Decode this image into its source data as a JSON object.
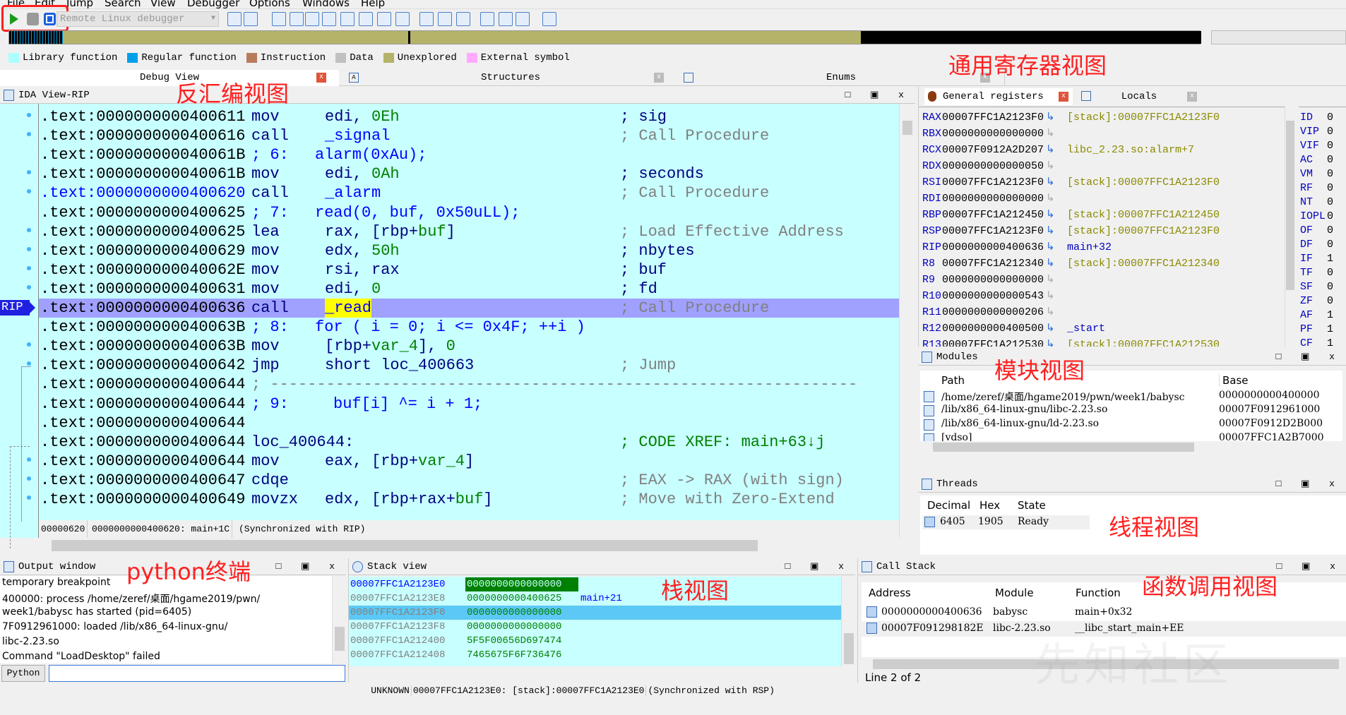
{
  "menu": [
    "File",
    "Edit",
    "Jump",
    "Search",
    "View",
    "Debugger",
    "Options",
    "Windows",
    "Help"
  ],
  "toolbar": {
    "debugger_select": "Remote Linux debugger",
    "icons": [
      "play-icon",
      "pause-icon",
      "stop-icon"
    ]
  },
  "legend": [
    {
      "label": "Library function",
      "color": "#aaffff"
    },
    {
      "label": "Regular function",
      "color": "#00a0e8"
    },
    {
      "label": "Instruction",
      "color": "#b87c5c"
    },
    {
      "label": "Data",
      "color": "#c0c0c0"
    },
    {
      "label": "Unexplored",
      "color": "#b5b36a"
    },
    {
      "label": "External symbol",
      "color": "#ffaaff"
    }
  ],
  "tabs": [
    "Debug View",
    "Structures",
    "Enums"
  ],
  "ida_view": {
    "title": "IDA View-RIP",
    "rip_label": "RIP",
    "lines": [
      {
        "addr": ".text:0000000000400611",
        "dot": true,
        "t": [
          [
            "mov",
            "nv",
            356
          ],
          [
            "edi, ",
            "nv",
            460
          ],
          [
            "0Eh",
            "gr",
            0
          ],
          [
            "; sig",
            "nv",
            878
          ]
        ]
      },
      {
        "addr": ".text:0000000000400616",
        "dot": true,
        "t": [
          [
            "call",
            "nv",
            356
          ],
          [
            "_signal",
            "bl",
            460
          ],
          [
            "; Call Procedure",
            "gy",
            878
          ]
        ]
      },
      {
        "addr": ".text:000000000040061B",
        "dot": false,
        "t": [
          [
            "; 6:",
            "bl",
            356
          ],
          [
            "alarm(0xAu);",
            "bl",
            446
          ]
        ]
      },
      {
        "addr": ".text:000000000040061B",
        "dot": true,
        "t": [
          [
            "mov",
            "nv",
            356
          ],
          [
            "edi, ",
            "nv",
            460
          ],
          [
            "0Ah",
            "gr",
            0
          ],
          [
            "; seconds",
            "nv",
            878
          ]
        ]
      },
      {
        "addr": ".text:0000000000400620",
        "addrblue": true,
        "dot": true,
        "t": [
          [
            "call",
            "nv",
            356
          ],
          [
            "_alarm",
            "bl",
            460
          ],
          [
            "; Call Procedure",
            "gy",
            878
          ]
        ]
      },
      {
        "addr": ".text:0000000000400625",
        "dot": false,
        "t": [
          [
            "; 7:",
            "bl",
            356
          ],
          [
            "read(0, buf, 0x50uLL);",
            "bl",
            446
          ]
        ]
      },
      {
        "addr": ".text:0000000000400625",
        "dot": true,
        "t": [
          [
            "lea",
            "nv",
            356
          ],
          [
            "rax, [rbp+",
            "nv",
            460
          ],
          [
            "buf",
            "gr",
            0
          ],
          [
            "]",
            "nv",
            0
          ],
          [
            "; Load Effective Address",
            "gy",
            878
          ]
        ]
      },
      {
        "addr": ".text:0000000000400629",
        "dot": true,
        "t": [
          [
            "mov",
            "nv",
            356
          ],
          [
            "edx, ",
            "nv",
            460
          ],
          [
            "50h",
            "gr",
            0
          ],
          [
            "; nbytes",
            "nv",
            878
          ]
        ]
      },
      {
        "addr": ".text:000000000040062E",
        "dot": true,
        "t": [
          [
            "mov",
            "nv",
            356
          ],
          [
            "rsi, rax",
            "nv",
            460
          ],
          [
            "; buf",
            "nv",
            878
          ]
        ]
      },
      {
        "addr": ".text:0000000000400631",
        "dot": true,
        "t": [
          [
            "mov",
            "nv",
            356
          ],
          [
            "edi, ",
            "nv",
            460
          ],
          [
            "0",
            "gr",
            0
          ],
          [
            "; fd",
            "nv",
            878
          ]
        ]
      },
      {
        "addr": ".text:0000000000400636",
        "dot": false,
        "current": true,
        "t": [
          [
            "call",
            "nv",
            356
          ],
          [
            "_read",
            "bl-hl",
            460
          ],
          [
            "; Call Procedure",
            "gy",
            878
          ]
        ]
      },
      {
        "addr": ".text:000000000040063B",
        "dot": false,
        "t": [
          [
            "; 8:",
            "bl",
            356
          ],
          [
            "for ( i = 0; i <= 0x4F; ++i )",
            "bl",
            446
          ]
        ]
      },
      {
        "addr": ".text:000000000040063B",
        "dot": true,
        "t": [
          [
            "mov",
            "nv",
            356
          ],
          [
            "[rbp+",
            "nv",
            460
          ],
          [
            "var_4",
            "gr",
            0
          ],
          [
            "], ",
            "nv",
            0
          ],
          [
            "0",
            "gr",
            0
          ]
        ]
      },
      {
        "addr": ".text:0000000000400642",
        "dot": true,
        "t": [
          [
            "jmp",
            "nv",
            356
          ],
          [
            "short loc_400663",
            "nv",
            460
          ],
          [
            "; Jump",
            "gy",
            878
          ]
        ]
      },
      {
        "addr": ".text:0000000000400644",
        "dot": false,
        "t": [
          [
            "; ---------------------------------------------------------------",
            "gy",
            356
          ]
        ]
      },
      {
        "addr": ".text:0000000000400644",
        "dot": false,
        "t": [
          [
            "; 9:",
            "bl",
            356
          ],
          [
            "buf[i] ^= i + 1;",
            "bl",
            472
          ]
        ]
      },
      {
        "addr": ".text:0000000000400644",
        "dot": false,
        "t": []
      },
      {
        "addr": ".text:0000000000400644",
        "dot": false,
        "t": [
          [
            "loc_400644:",
            "nv",
            356
          ],
          [
            "; CODE XREF: main+63↓j",
            "gr",
            878
          ]
        ]
      },
      {
        "addr": ".text:0000000000400644",
        "dot": true,
        "t": [
          [
            "mov",
            "nv",
            356
          ],
          [
            "eax, [rbp+",
            "nv",
            460
          ],
          [
            "var_4",
            "gr",
            0
          ],
          [
            "]",
            "nv",
            0
          ]
        ]
      },
      {
        "addr": ".text:0000000000400647",
        "dot": true,
        "t": [
          [
            "cdqe",
            "nv",
            356
          ],
          [
            "; EAX -> RAX (with sign)",
            "gy",
            878
          ]
        ]
      },
      {
        "addr": ".text:0000000000400649",
        "dot": true,
        "t": [
          [
            "movzx",
            "nv",
            356
          ],
          [
            "edx, [rbp+rax+",
            "nv",
            460
          ],
          [
            "buf",
            "gr",
            0
          ],
          [
            "]",
            "nv",
            0
          ],
          [
            "; Move with Zero-Extend",
            "gy",
            878
          ]
        ]
      }
    ],
    "status": [
      "00000620",
      "0000000000400620: main+1C",
      "(Synchronized with RIP)"
    ]
  },
  "registers": {
    "tab_label": "General registers",
    "locals_tab": "Locals",
    "rows": [
      [
        "RAX",
        "00007FFC1A2123F0",
        "[stack]:00007FFC1A2123F0"
      ],
      [
        "RBX",
        "0000000000000000",
        ""
      ],
      [
        "RCX",
        "00007F0912A2D207",
        "libc_2.23.so:alarm+7"
      ],
      [
        "RDX",
        "0000000000000050",
        ""
      ],
      [
        "RSI",
        "00007FFC1A2123F0",
        "[stack]:00007FFC1A2123F0"
      ],
      [
        "RDI",
        "0000000000000000",
        ""
      ],
      [
        "RBP",
        "00007FFC1A212450",
        "[stack]:00007FFC1A212450"
      ],
      [
        "RSP",
        "00007FFC1A2123F0",
        "[stack]:00007FFC1A2123F0"
      ],
      [
        "RIP",
        "0000000000400636",
        "main+32"
      ],
      [
        "R8",
        "00007FFC1A212340",
        "[stack]:00007FFC1A212340"
      ],
      [
        "R9",
        "0000000000000000",
        ""
      ],
      [
        "R10",
        "0000000000000543",
        ""
      ],
      [
        "R11",
        "0000000000000206",
        ""
      ],
      [
        "R12",
        "0000000000400500",
        "_start"
      ],
      [
        "R13",
        "00007FFC1A212530",
        "[stack]:00007FFC1A212530"
      ]
    ],
    "flags": [
      [
        "ID",
        "0"
      ],
      [
        "VIP",
        "0"
      ],
      [
        "VIF",
        "0"
      ],
      [
        "AC",
        "0"
      ],
      [
        "VM",
        "0"
      ],
      [
        "RF",
        "0"
      ],
      [
        "NT",
        "0"
      ],
      [
        "IOPL",
        "0"
      ],
      [
        "OF",
        "0"
      ],
      [
        "DF",
        "0"
      ],
      [
        "IF",
        "1"
      ],
      [
        "TF",
        "0"
      ],
      [
        "SF",
        "0"
      ],
      [
        "ZF",
        "0"
      ],
      [
        "AF",
        "1"
      ],
      [
        "PF",
        "1"
      ],
      [
        "CF",
        "1"
      ]
    ]
  },
  "modules": {
    "title": "Modules",
    "columns": [
      "Path",
      "Base"
    ],
    "rows": [
      [
        "/home/zeref/桌面/hgame2019/pwn/week1/babysc",
        "0000000000400000"
      ],
      [
        "/lib/x86_64-linux-gnu/libc-2.23.so",
        "00007F0912961000"
      ],
      [
        "/lib/x86_64-linux-gnu/ld-2.23.so",
        "00007F0912D2B000"
      ],
      [
        "[vdso]",
        "00007FFC1A2B7000"
      ]
    ]
  },
  "threads": {
    "title": "Threads",
    "columns": [
      "Decimal",
      "Hex",
      "State"
    ],
    "rows": [
      [
        "6405",
        "1905",
        "Ready"
      ]
    ]
  },
  "output": {
    "title": "Output window",
    "lines": [
      "temporary breakpoint",
      "400000: process /home/zeref/桌面/hgame2019/pwn/",
      "week1/babysc has started (pid=6405)",
      "7F0912961000: loaded /lib/x86_64-linux-gnu/",
      "libc-2.23.so",
      "Command \"LoadDesktop\" failed"
    ],
    "python_button": "Python",
    "input_value": ""
  },
  "stack": {
    "title": "Stack view",
    "rows": [
      [
        "00007FFC1A2123E0",
        "0000000000000000",
        ""
      ],
      [
        "00007FFC1A2123E8",
        "0000000000400625",
        "main+21"
      ],
      [
        "00007FFC1A2123F0",
        "0000000000000000",
        ""
      ],
      [
        "00007FFC1A2123F8",
        "0000000000000000",
        ""
      ],
      [
        "00007FFC1A212400",
        "5F5F00656D697474",
        ""
      ],
      [
        "00007FFC1A212408",
        "7465675F6F736476",
        ""
      ]
    ],
    "status": [
      "UNKNOWN",
      "00007FFC1A2123E0: [stack]:00007FFC1A2123E0",
      "(Synchronized with RSP)"
    ]
  },
  "callstack": {
    "title": "Call Stack",
    "columns": [
      "Address",
      "Module",
      "Function"
    ],
    "rows": [
      [
        "0000000000400636",
        "babysc",
        "main+0x32"
      ],
      [
        "00007F091298182E",
        "libc-2.23.so",
        "__libc_start_main+EE"
      ]
    ],
    "status": "Line 2 of 2"
  },
  "annotations": {
    "registers": "通用寄存器视图",
    "disasm": "反汇编视图",
    "modules": "模块视图",
    "threads": "线程视图",
    "python": "python终端",
    "stack": "栈视图",
    "callstack": "函数调用视图"
  },
  "watermark": "先知社区",
  "colors": {
    "code_bg": "#c8ffff",
    "current_line": "#a0a0ff",
    "annotation": "#ff2020"
  }
}
